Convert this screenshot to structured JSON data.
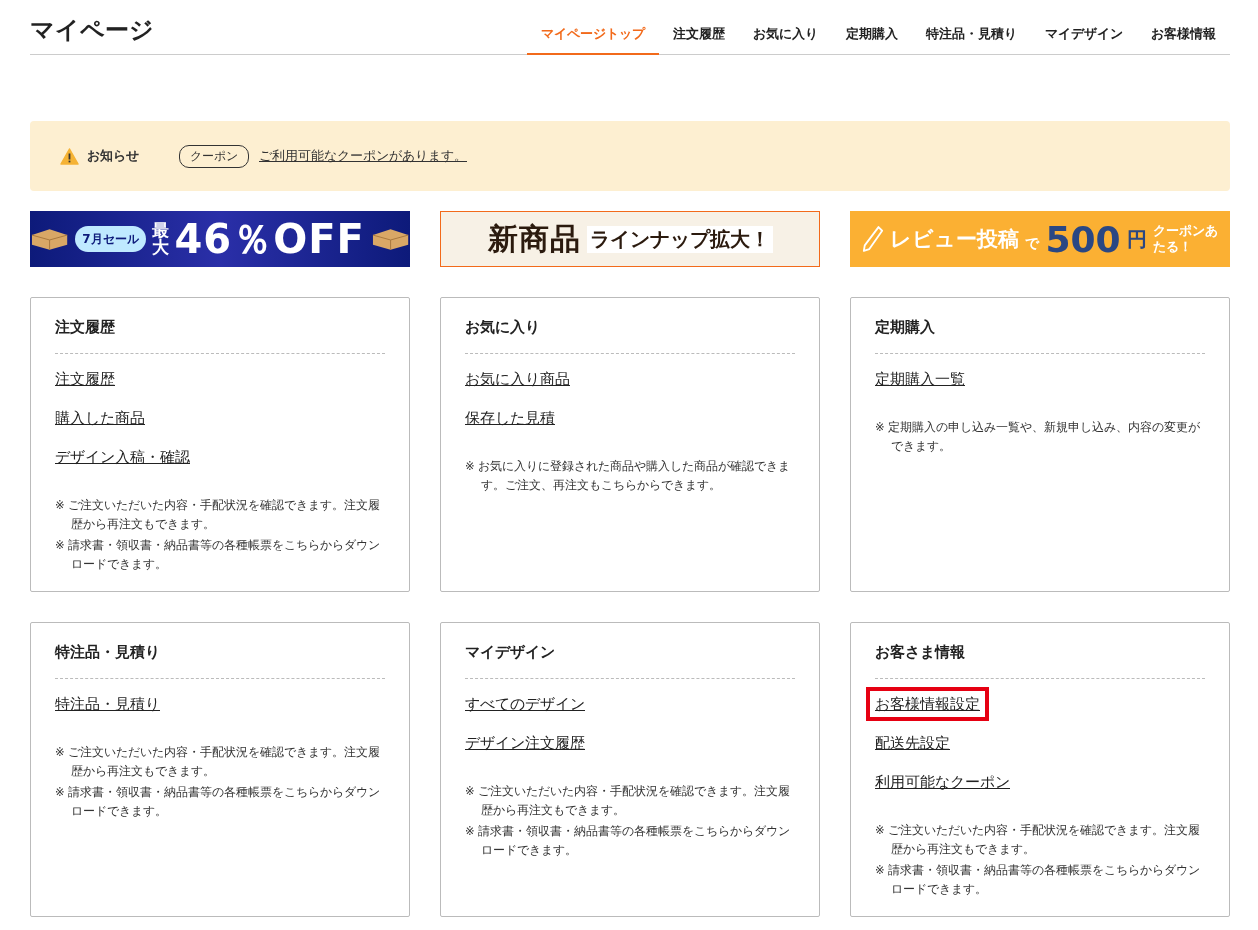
{
  "page_title": "マイページ",
  "nav": [
    {
      "label": "マイページトップ",
      "selected": true
    },
    {
      "label": "注文履歴",
      "selected": false
    },
    {
      "label": "お気に入り",
      "selected": false
    },
    {
      "label": "定期購入",
      "selected": false
    },
    {
      "label": "特注品・見積り",
      "selected": false
    },
    {
      "label": "マイデザイン",
      "selected": false
    },
    {
      "label": "お客様情報",
      "selected": false
    }
  ],
  "notice": {
    "label": "お知らせ",
    "tag": "クーポン",
    "message": "ご利用可能なクーポンがあります。"
  },
  "banners": [
    {
      "kind": "sale",
      "badge": "7月セール",
      "lead": "最大",
      "headline": "46％OFF"
    },
    {
      "kind": "new",
      "headline": "新商品",
      "tail": "ラインナップ拡大！"
    },
    {
      "kind": "review",
      "lead": "レビュー投稿",
      "joiner": "で",
      "headline": "500",
      "unit": "円",
      "tail": "クーポンあたる！"
    }
  ],
  "cards": [
    {
      "title": "注文履歴",
      "links": [
        {
          "label": "注文履歴",
          "highlighted": false
        },
        {
          "label": "購入した商品",
          "highlighted": false
        },
        {
          "label": "デザイン入稿・確認",
          "highlighted": false
        }
      ],
      "notes": [
        "※ ご注文いただいた内容・手配状況を確認できます。注文履歴から再注文もできます。",
        "※ 請求書・領収書・納品書等の各種帳票をこちらからダウンロードできます。"
      ]
    },
    {
      "title": "お気に入り",
      "links": [
        {
          "label": "お気に入り商品",
          "highlighted": false
        },
        {
          "label": "保存した見積",
          "highlighted": false
        }
      ],
      "notes": [
        "※ お気に入りに登録された商品や購入した商品が確認できます。ご注文、再注文もこちらからできます。"
      ]
    },
    {
      "title": "定期購入",
      "links": [
        {
          "label": "定期購入一覧",
          "highlighted": false
        }
      ],
      "notes": [
        "※ 定期購入の申し込み一覧や、新規申し込み、内容の変更ができます。"
      ]
    },
    {
      "title": "特注品・見積り",
      "links": [
        {
          "label": "特注品・見積り",
          "highlighted": false
        }
      ],
      "notes": [
        "※ ご注文いただいた内容・手配状況を確認できます。注文履歴から再注文もできます。",
        "※ 請求書・領収書・納品書等の各種帳票をこちらからダウンロードできます。"
      ]
    },
    {
      "title": "マイデザイン",
      "links": [
        {
          "label": "すべてのデザイン",
          "highlighted": false
        },
        {
          "label": "デザイン注文履歴",
          "highlighted": false
        }
      ],
      "notes": [
        "※ ご注文いただいた内容・手配状況を確認できます。注文履歴から再注文もできます。",
        "※ 請求書・領収書・納品書等の各種帳票をこちらからダウンロードできます。"
      ]
    },
    {
      "title": "お客さま情報",
      "links": [
        {
          "label": "お客様情報設定",
          "highlighted": true
        },
        {
          "label": "配送先設定",
          "highlighted": false
        },
        {
          "label": "利用可能なクーポン",
          "highlighted": false
        }
      ],
      "notes": [
        "※ ご注文いただいた内容・手配状況を確認できます。注文履歴から再注文もできます。",
        "※ 請求書・領収書・納品書等の各種帳票をこちらからダウンロードできます。"
      ]
    }
  ]
}
